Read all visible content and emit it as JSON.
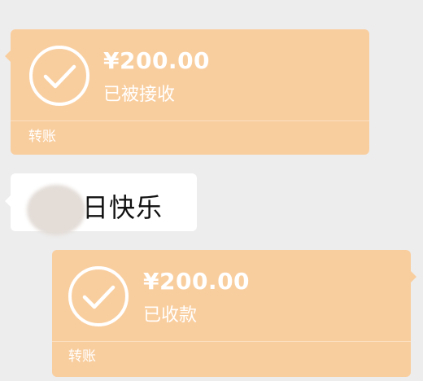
{
  "chat": {
    "messages": [
      {
        "type": "transfer",
        "side": "left",
        "amount": "¥200.00",
        "status": "已被接收",
        "label": "转账",
        "icon": "check-circle-icon"
      },
      {
        "type": "text",
        "side": "left",
        "text": "生日快乐"
      },
      {
        "type": "transfer",
        "side": "right",
        "amount": "¥200.00",
        "status": "已收款",
        "label": "转账",
        "icon": "check-circle-icon"
      }
    ]
  },
  "colors": {
    "background": "#ededed",
    "transfer_card": "#f9ce9f",
    "text_bubble": "#ffffff",
    "card_text": "#ffffff",
    "message_text": "#111111"
  }
}
